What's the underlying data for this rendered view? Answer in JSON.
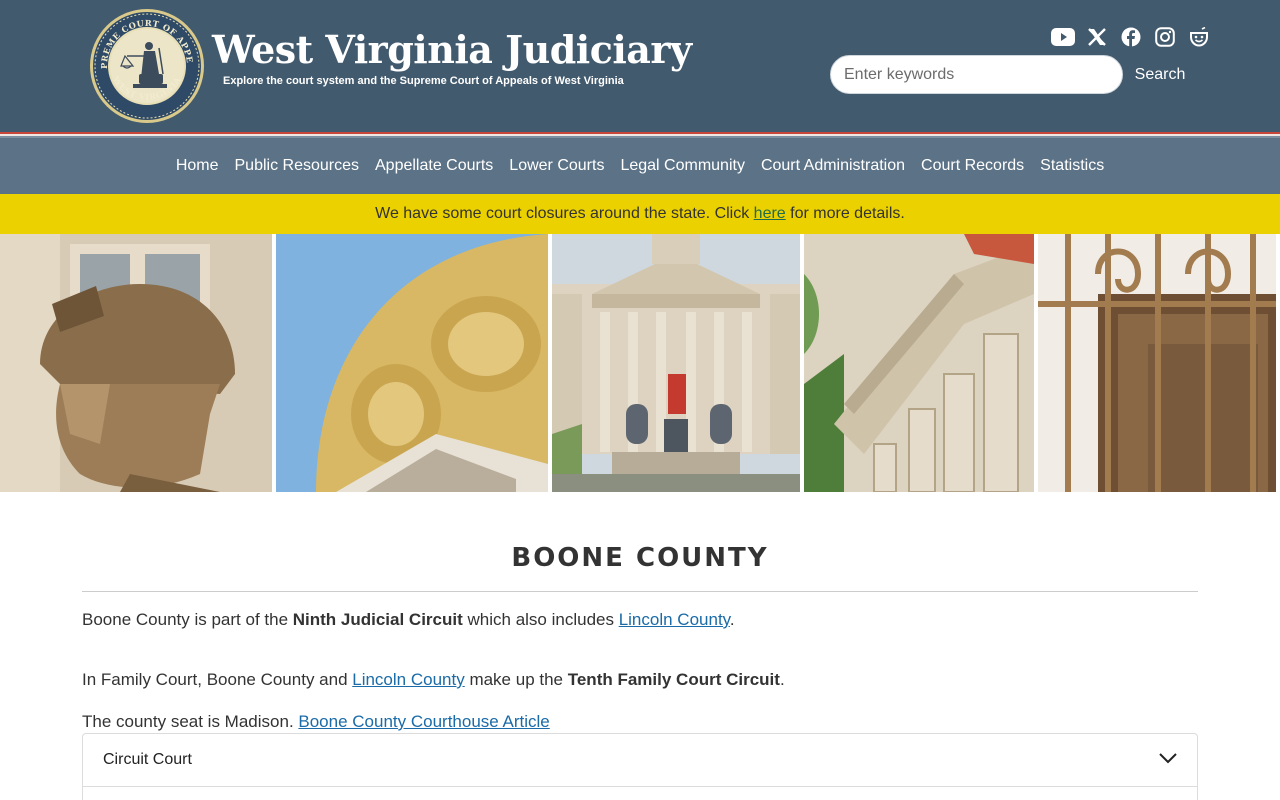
{
  "header": {
    "seal_text_top": "SUPREME COURT OF APPEALS",
    "seal_text_bottom": "WEST VIRGINIA",
    "site_title": "West Virginia Judiciary",
    "tagline": "Explore the court system and the Supreme Court of Appeals of West Virginia",
    "social_icons": [
      "youtube-icon",
      "x-icon",
      "facebook-icon",
      "instagram-icon",
      "smile-icon"
    ],
    "search": {
      "placeholder": "Enter keywords",
      "value": "",
      "button_label": "Search"
    }
  },
  "nav": {
    "items": [
      "Home",
      "Public Resources",
      "Appellate Courts",
      "Lower Courts",
      "Legal Community",
      "Court Administration",
      "Court Records",
      "Statistics"
    ]
  },
  "alert": {
    "text_before": "We have some court closures around the state. Click ",
    "link_text": "here",
    "text_after": " for more details."
  },
  "colors": {
    "header_bg": "#425a6e",
    "nav_bg": "#5b7287",
    "alert_bg": "#ecd100",
    "link": "#1a6ba8",
    "alert_link": "#1f6b4a"
  },
  "main": {
    "title": "BOONE COUNTY",
    "p1": {
      "a": "Boone County is part of the ",
      "bold": "Ninth Judicial Circuit",
      "b": " which also includes ",
      "link": "Lincoln County",
      "c": "."
    },
    "p2": {
      "a": "In Family Court, Boone County and ",
      "link": "Lincoln County",
      "b": " make up the ",
      "bold": "Tenth Family Court Circuit",
      "c": "."
    },
    "p3": {
      "a": "The county seat is Madison. ",
      "link": "Boone County Courthouse Article"
    },
    "accordion": [
      {
        "label": "Circuit Court",
        "icon": "chevron-down-icon"
      }
    ]
  }
}
